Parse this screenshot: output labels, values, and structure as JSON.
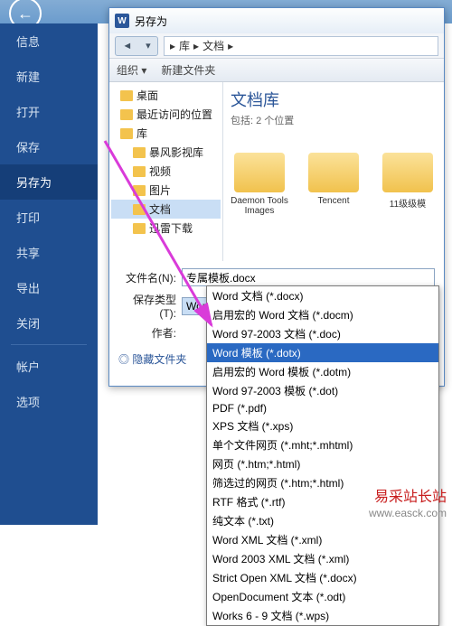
{
  "sidebar": {
    "items": [
      {
        "label": "信息"
      },
      {
        "label": "新建"
      },
      {
        "label": "打开"
      },
      {
        "label": "保存"
      },
      {
        "label": "另存为",
        "active": true
      },
      {
        "label": "打印"
      },
      {
        "label": "共享"
      },
      {
        "label": "导出"
      },
      {
        "label": "关闭"
      }
    ],
    "bottom": [
      {
        "label": "帐户"
      },
      {
        "label": "选项"
      }
    ]
  },
  "dialog": {
    "title": "另存为",
    "path": {
      "lib": "库",
      "docs": "文档"
    },
    "toolbar": {
      "organize": "组织 ▾",
      "newfolder": "新建文件夹"
    },
    "tree": [
      {
        "label": "桌面"
      },
      {
        "label": "最近访问的位置"
      },
      {
        "label": "库",
        "bold": true
      },
      {
        "label": "暴风影视库",
        "sub": true
      },
      {
        "label": "视频",
        "sub": true
      },
      {
        "label": "图片",
        "sub": true
      },
      {
        "label": "文档",
        "sub": true,
        "sel": true
      },
      {
        "label": "迅雷下载",
        "sub": true
      }
    ],
    "content": {
      "title": "文档库",
      "sub": "包括: 2 个位置",
      "folders": [
        {
          "name": "Daemon Tools Images"
        },
        {
          "name": "Tencent"
        },
        {
          "name": "11级级模"
        }
      ]
    },
    "filename_label": "文件名(N):",
    "filename_value": "专属模板.docx",
    "filetype_label": "保存类型(T):",
    "filetype_value": "Word 文档 (*.docx)",
    "author_label": "作者:",
    "expand": "◎ 隐藏文件夹"
  },
  "dropdown": [
    "Word 文档 (*.docx)",
    "启用宏的 Word 文档 (*.docm)",
    "Word 97-2003 文档 (*.doc)",
    "Word 模板 (*.dotx)",
    "启用宏的 Word 模板 (*.dotm)",
    "Word 97-2003 模板 (*.dot)",
    "PDF (*.pdf)",
    "XPS 文档 (*.xps)",
    "单个文件网页 (*.mht;*.mhtml)",
    "网页 (*.htm;*.html)",
    "筛选过的网页 (*.htm;*.html)",
    "RTF 格式 (*.rtf)",
    "纯文本 (*.txt)",
    "Word XML 文档 (*.xml)",
    "Word 2003 XML 文档 (*.xml)",
    "Strict Open XML 文档 (*.docx)",
    "OpenDocument 文本 (*.odt)",
    "Works 6 - 9 文档 (*.wps)"
  ],
  "dropdown_highlight": 3,
  "watermark": {
    "cn": "易采站长站",
    "en": "www.easck.com"
  }
}
